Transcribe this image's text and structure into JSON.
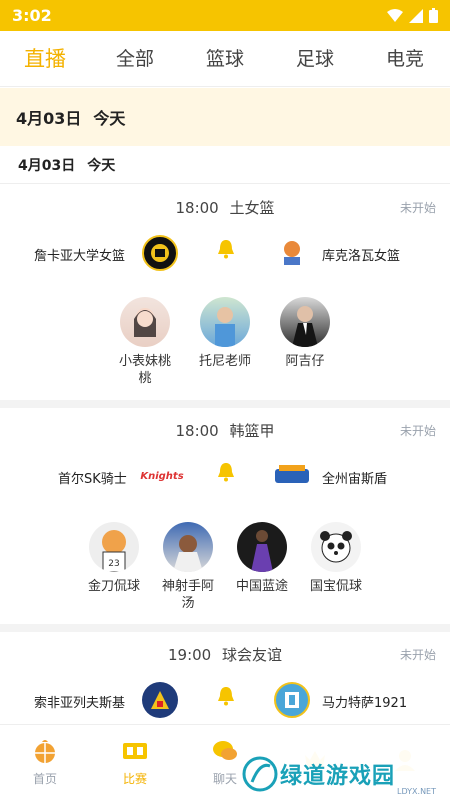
{
  "status_bar": {
    "time": "3:02"
  },
  "top_tabs": [
    {
      "label": "直播",
      "active": true
    },
    {
      "label": "全部",
      "active": false
    },
    {
      "label": "篮球",
      "active": false
    },
    {
      "label": "足球",
      "active": false
    },
    {
      "label": "电竞",
      "active": false
    }
  ],
  "date_header": {
    "date": "4月03日",
    "day": "今天"
  },
  "date_sub": {
    "date": "4月03日",
    "day": "今天"
  },
  "matches": [
    {
      "time": "18:00",
      "league": "土女篮",
      "status": "未开始",
      "home": "詹卡亚大学女篮",
      "away": "库克洛瓦女篮",
      "anchors": [
        "小表妹桃桃",
        "托尼老师",
        "阿吉仔"
      ]
    },
    {
      "time": "18:00",
      "league": "韩篮甲",
      "status": "未开始",
      "home": "首尔SK骑士",
      "away": "全州宙斯盾",
      "home_logo_text": "Knights",
      "anchors": [
        "金刀侃球",
        "神射手阿汤",
        "中国蓝途",
        "国宝侃球"
      ]
    },
    {
      "time": "19:00",
      "league": "球会友谊",
      "status": "未开始",
      "home": "索非亚列夫斯基",
      "away": "马力特萨1921"
    }
  ],
  "bottom_nav": [
    {
      "label": "首页",
      "active": false
    },
    {
      "label": "比赛",
      "active": true
    },
    {
      "label": "聊天",
      "active": false
    }
  ],
  "watermark": {
    "text": "绿道游戏园",
    "sub": "LDYX.NET"
  },
  "colors": {
    "accent": "#f6c400",
    "active_text": "#f4b200",
    "status_gray": "#9aa2ad"
  }
}
